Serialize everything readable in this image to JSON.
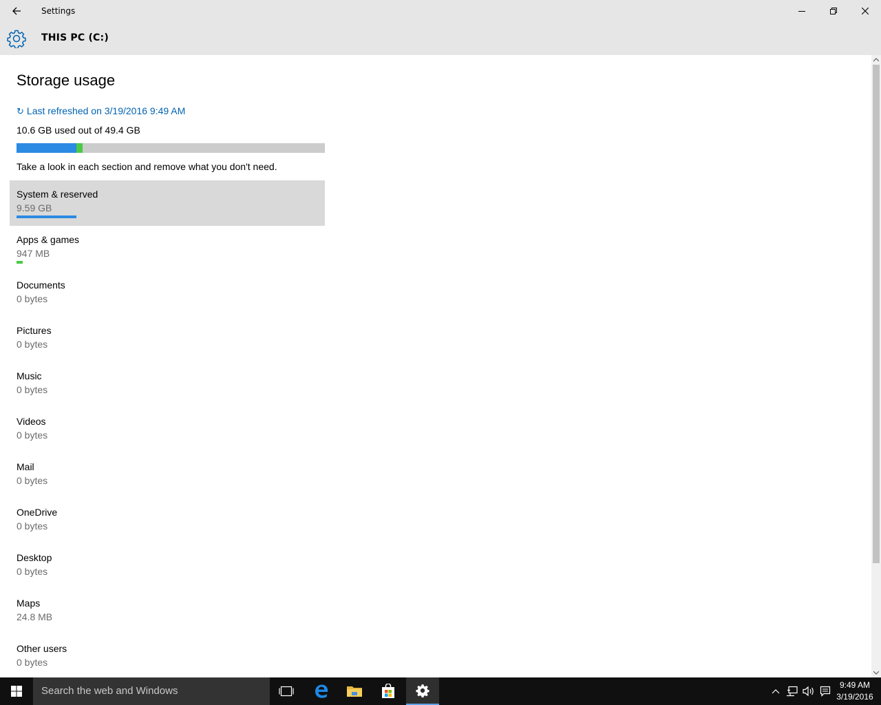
{
  "window": {
    "title": "Settings",
    "header_title": "THIS PC (C:)"
  },
  "page": {
    "title": "Storage usage",
    "refresh_text": "Last refreshed on 3/19/2016 9:49 AM",
    "used_text": "10.6 GB used out of 49.4 GB",
    "hint": "Take a look in each section and remove what you don't need.",
    "usage_bar": {
      "system_fraction": 0.194,
      "apps_fraction": 0.019,
      "system_color": "#2b8ae2",
      "apps_color": "#4cc947",
      "track_color": "#cccccc"
    }
  },
  "categories": [
    {
      "name": "System & reserved",
      "size": "9.59 GB",
      "selected": true,
      "fraction": 0.194,
      "color": "#2b8ae2"
    },
    {
      "name": "Apps & games",
      "size": "947 MB",
      "selected": false,
      "fraction": 0.019,
      "color": "#4cc947"
    },
    {
      "name": "Documents",
      "size": "0 bytes",
      "selected": false,
      "fraction": 0
    },
    {
      "name": "Pictures",
      "size": "0 bytes",
      "selected": false,
      "fraction": 0
    },
    {
      "name": "Music",
      "size": "0 bytes",
      "selected": false,
      "fraction": 0
    },
    {
      "name": "Videos",
      "size": "0 bytes",
      "selected": false,
      "fraction": 0
    },
    {
      "name": "Mail",
      "size": "0 bytes",
      "selected": false,
      "fraction": 0
    },
    {
      "name": "OneDrive",
      "size": "0 bytes",
      "selected": false,
      "fraction": 0
    },
    {
      "name": "Desktop",
      "size": "0 bytes",
      "selected": false,
      "fraction": 0
    },
    {
      "name": "Maps",
      "size": "24.8 MB",
      "selected": false,
      "fraction": 0
    },
    {
      "name": "Other users",
      "size": "0 bytes",
      "selected": false,
      "fraction": 0
    }
  ],
  "taskbar": {
    "search_placeholder": "Search the web and Windows",
    "time": "9:49 AM",
    "date": "3/19/2016",
    "icons": [
      "task-view-icon",
      "edge-icon",
      "file-explorer-icon",
      "store-icon",
      "settings-icon"
    ]
  },
  "colors": {
    "accent": "#0063b1",
    "chrome": "#e6e6e6",
    "taskbar": "#101010"
  }
}
